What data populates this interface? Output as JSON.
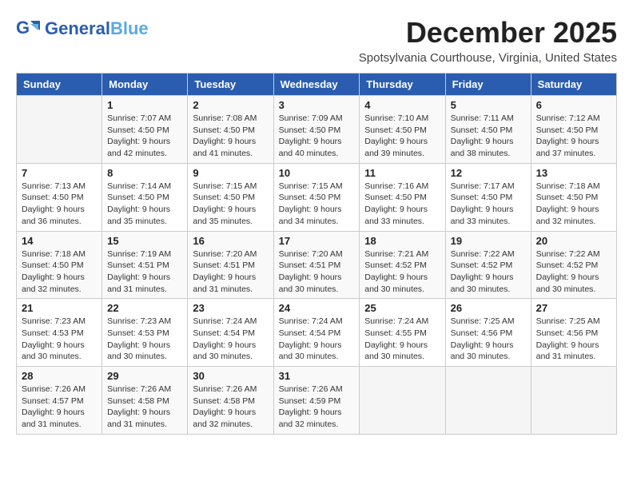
{
  "header": {
    "logo_general": "General",
    "logo_blue": "Blue",
    "month_title": "December 2025",
    "location": "Spotsylvania Courthouse, Virginia, United States"
  },
  "days_of_week": [
    "Sunday",
    "Monday",
    "Tuesday",
    "Wednesday",
    "Thursday",
    "Friday",
    "Saturday"
  ],
  "weeks": [
    [
      {
        "day": "",
        "info": ""
      },
      {
        "day": "1",
        "info": "Sunrise: 7:07 AM\nSunset: 4:50 PM\nDaylight: 9 hours\nand 42 minutes."
      },
      {
        "day": "2",
        "info": "Sunrise: 7:08 AM\nSunset: 4:50 PM\nDaylight: 9 hours\nand 41 minutes."
      },
      {
        "day": "3",
        "info": "Sunrise: 7:09 AM\nSunset: 4:50 PM\nDaylight: 9 hours\nand 40 minutes."
      },
      {
        "day": "4",
        "info": "Sunrise: 7:10 AM\nSunset: 4:50 PM\nDaylight: 9 hours\nand 39 minutes."
      },
      {
        "day": "5",
        "info": "Sunrise: 7:11 AM\nSunset: 4:50 PM\nDaylight: 9 hours\nand 38 minutes."
      },
      {
        "day": "6",
        "info": "Sunrise: 7:12 AM\nSunset: 4:50 PM\nDaylight: 9 hours\nand 37 minutes."
      }
    ],
    [
      {
        "day": "7",
        "info": "Sunrise: 7:13 AM\nSunset: 4:50 PM\nDaylight: 9 hours\nand 36 minutes."
      },
      {
        "day": "8",
        "info": "Sunrise: 7:14 AM\nSunset: 4:50 PM\nDaylight: 9 hours\nand 35 minutes."
      },
      {
        "day": "9",
        "info": "Sunrise: 7:15 AM\nSunset: 4:50 PM\nDaylight: 9 hours\nand 35 minutes."
      },
      {
        "day": "10",
        "info": "Sunrise: 7:15 AM\nSunset: 4:50 PM\nDaylight: 9 hours\nand 34 minutes."
      },
      {
        "day": "11",
        "info": "Sunrise: 7:16 AM\nSunset: 4:50 PM\nDaylight: 9 hours\nand 33 minutes."
      },
      {
        "day": "12",
        "info": "Sunrise: 7:17 AM\nSunset: 4:50 PM\nDaylight: 9 hours\nand 33 minutes."
      },
      {
        "day": "13",
        "info": "Sunrise: 7:18 AM\nSunset: 4:50 PM\nDaylight: 9 hours\nand 32 minutes."
      }
    ],
    [
      {
        "day": "14",
        "info": "Sunrise: 7:18 AM\nSunset: 4:50 PM\nDaylight: 9 hours\nand 32 minutes."
      },
      {
        "day": "15",
        "info": "Sunrise: 7:19 AM\nSunset: 4:51 PM\nDaylight: 9 hours\nand 31 minutes."
      },
      {
        "day": "16",
        "info": "Sunrise: 7:20 AM\nSunset: 4:51 PM\nDaylight: 9 hours\nand 31 minutes."
      },
      {
        "day": "17",
        "info": "Sunrise: 7:20 AM\nSunset: 4:51 PM\nDaylight: 9 hours\nand 30 minutes."
      },
      {
        "day": "18",
        "info": "Sunrise: 7:21 AM\nSunset: 4:52 PM\nDaylight: 9 hours\nand 30 minutes."
      },
      {
        "day": "19",
        "info": "Sunrise: 7:22 AM\nSunset: 4:52 PM\nDaylight: 9 hours\nand 30 minutes."
      },
      {
        "day": "20",
        "info": "Sunrise: 7:22 AM\nSunset: 4:52 PM\nDaylight: 9 hours\nand 30 minutes."
      }
    ],
    [
      {
        "day": "21",
        "info": "Sunrise: 7:23 AM\nSunset: 4:53 PM\nDaylight: 9 hours\nand 30 minutes."
      },
      {
        "day": "22",
        "info": "Sunrise: 7:23 AM\nSunset: 4:53 PM\nDaylight: 9 hours\nand 30 minutes."
      },
      {
        "day": "23",
        "info": "Sunrise: 7:24 AM\nSunset: 4:54 PM\nDaylight: 9 hours\nand 30 minutes."
      },
      {
        "day": "24",
        "info": "Sunrise: 7:24 AM\nSunset: 4:54 PM\nDaylight: 9 hours\nand 30 minutes."
      },
      {
        "day": "25",
        "info": "Sunrise: 7:24 AM\nSunset: 4:55 PM\nDaylight: 9 hours\nand 30 minutes."
      },
      {
        "day": "26",
        "info": "Sunrise: 7:25 AM\nSunset: 4:56 PM\nDaylight: 9 hours\nand 30 minutes."
      },
      {
        "day": "27",
        "info": "Sunrise: 7:25 AM\nSunset: 4:56 PM\nDaylight: 9 hours\nand 31 minutes."
      }
    ],
    [
      {
        "day": "28",
        "info": "Sunrise: 7:26 AM\nSunset: 4:57 PM\nDaylight: 9 hours\nand 31 minutes."
      },
      {
        "day": "29",
        "info": "Sunrise: 7:26 AM\nSunset: 4:58 PM\nDaylight: 9 hours\nand 31 minutes."
      },
      {
        "day": "30",
        "info": "Sunrise: 7:26 AM\nSunset: 4:58 PM\nDaylight: 9 hours\nand 32 minutes."
      },
      {
        "day": "31",
        "info": "Sunrise: 7:26 AM\nSunset: 4:59 PM\nDaylight: 9 hours\nand 32 minutes."
      },
      {
        "day": "",
        "info": ""
      },
      {
        "day": "",
        "info": ""
      },
      {
        "day": "",
        "info": ""
      }
    ]
  ]
}
